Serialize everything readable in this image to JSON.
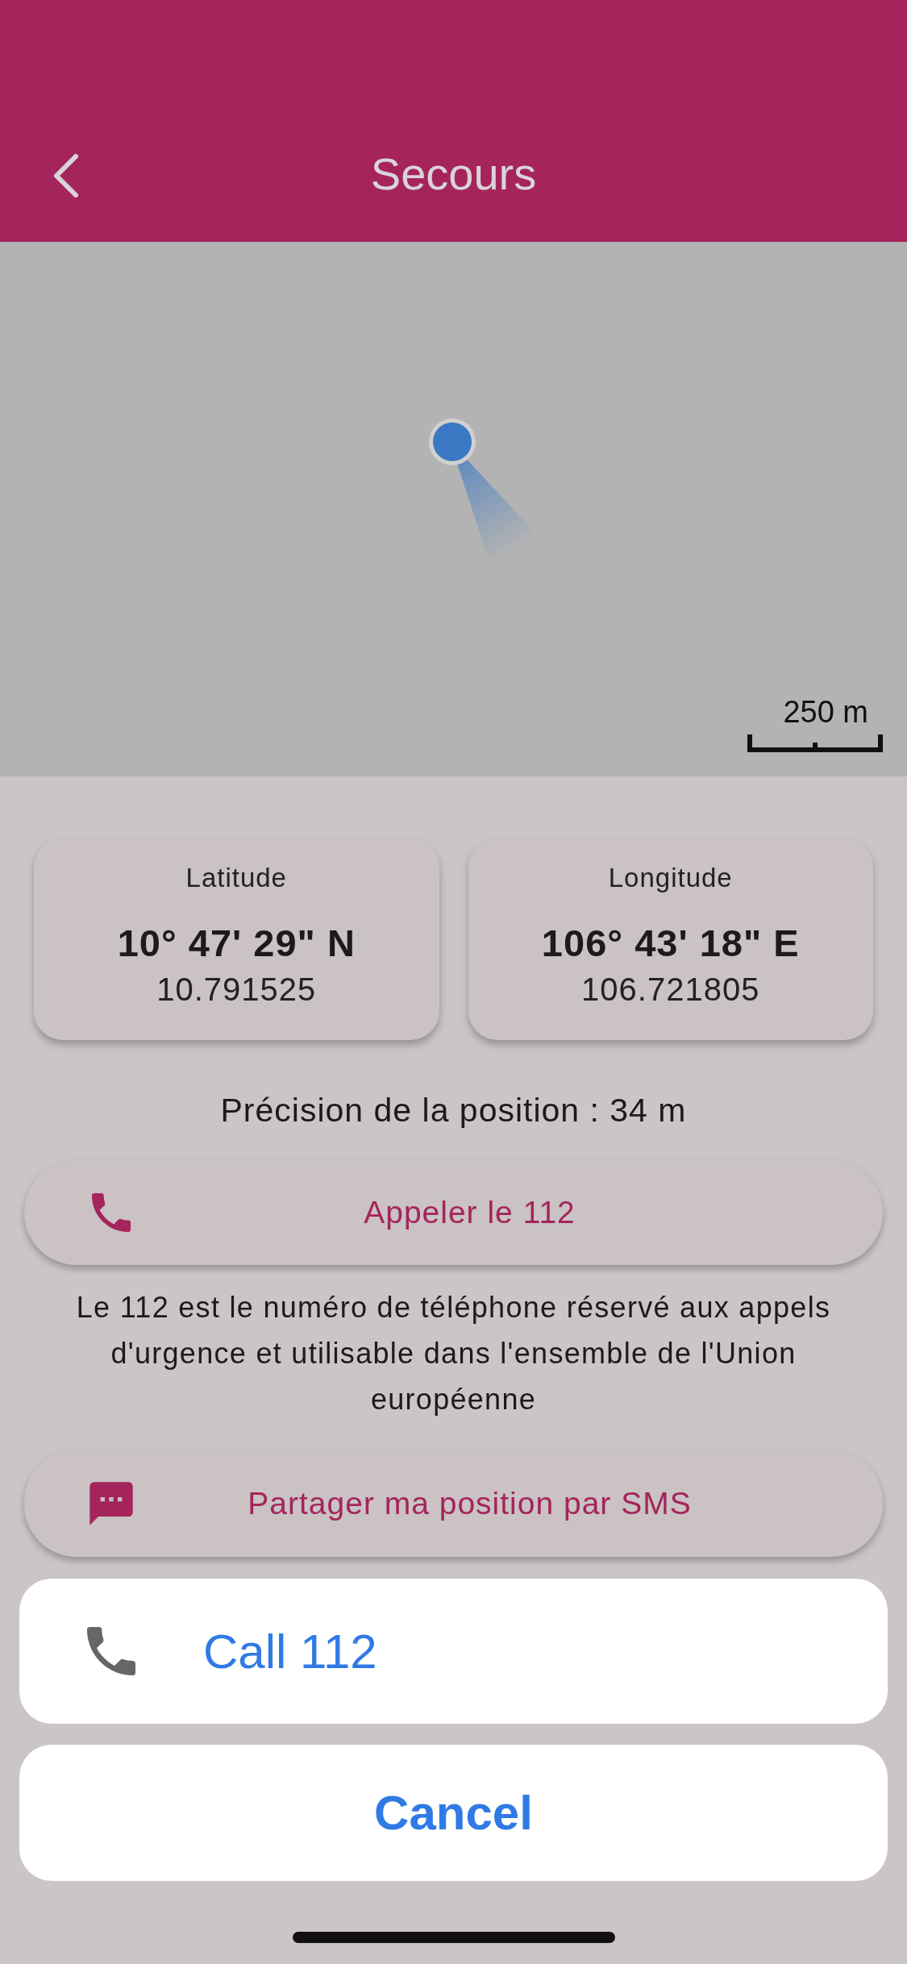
{
  "header": {
    "title": "Secours"
  },
  "map": {
    "scale": "250 m"
  },
  "coordinates": [
    {
      "label": "Latitude",
      "dms": "10° 47' 29\" N",
      "decimal": "10.791525"
    },
    {
      "label": "Longitude",
      "dms": "106° 43' 18\" E",
      "decimal": "106.721805"
    }
  ],
  "precision": "Précision de la position : 34 m",
  "call_action": {
    "kind": "call",
    "label": "Appeler le 112"
  },
  "notice": "Le 112 est le numéro de téléphone réservé aux appels d'urgence et utilisable dans l'ensemble de l'Union européenne",
  "sms_action": {
    "kind": "sms",
    "label": "Partager ma position par SMS"
  },
  "action_sheet": {
    "options": [
      {
        "label": "Call 112"
      }
    ],
    "cancel": "Cancel"
  }
}
